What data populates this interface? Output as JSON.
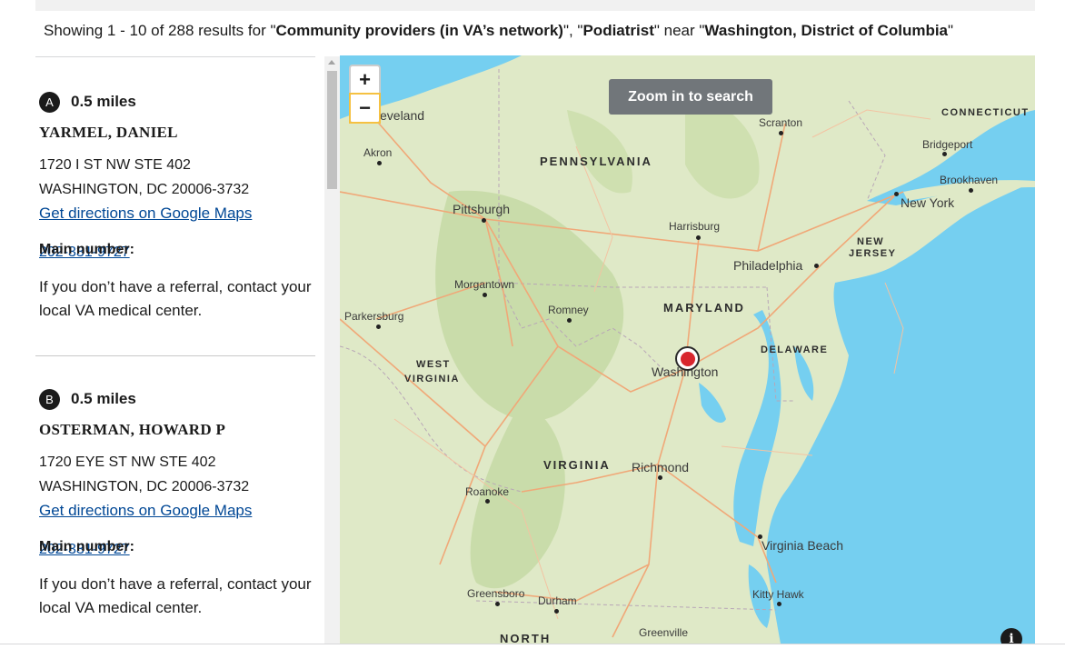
{
  "summary": {
    "prefix": "Showing 1 - 10 of 288 results for \"",
    "service_type": "Community providers (in VA’s network)",
    "mid1": "\", \"",
    "specialty": "Podiatrist",
    "mid2": "\" near \"",
    "location": "Washington, District of Columbia",
    "suffix": "\""
  },
  "results": [
    {
      "marker": "A",
      "distance": "0.5 miles",
      "name": "YARMEL, DANIEL",
      "address_line1": "1720 I ST NW STE 402",
      "address_line2": "WASHINGTON, DC 20006-3732",
      "directions_label": "Get directions on Google Maps",
      "phone_label": "Main number:",
      "phone": "202-331-9727",
      "note": "If you don’t have a referral, contact your local VA medical center."
    },
    {
      "marker": "B",
      "distance": "0.5 miles",
      "name": "OSTERMAN, HOWARD P",
      "address_line1": "1720 EYE ST NW STE 402",
      "address_line2": "WASHINGTON, DC 20006-3732",
      "directions_label": "Get directions on Google Maps",
      "phone_label": "Main number:",
      "phone": "202-331-9727",
      "note": "If you don’t have a referral, contact your local VA medical center."
    }
  ],
  "map": {
    "zoom_in_label": "+",
    "zoom_out_label": "−",
    "zoom_to_search_label": "Zoom in to search",
    "info_label": "i",
    "states": {
      "pennsylvania": "PENNSYLVANIA",
      "connecticut": "CONNECTICUT",
      "new_jersey_1": "NEW",
      "new_jersey_2": "JERSEY",
      "maryland": "MARYLAND",
      "delaware": "DELAWARE",
      "west_virginia_1": "WEST",
      "west_virginia_2": "VIRGINIA",
      "virginia": "VIRGINIA",
      "north": "NORTH"
    },
    "cities": {
      "cleveland": "eveland",
      "akron": "Akron",
      "scranton": "Scranton",
      "bridgeport": "Bridgeport",
      "brookhaven": "Brookhaven",
      "new_york": "New York",
      "pittsburgh": "Pittsburgh",
      "harrisburg": "Harrisburg",
      "philadelphia": "Philadelphia",
      "morgantown": "Morgantown",
      "romney": "Romney",
      "parkersburg": "Parkersburg",
      "washington": "Washington",
      "richmond": "Richmond",
      "roanoke": "Roanoke",
      "virginia_beach": "Virginia Beach",
      "kitty_hawk": "Kitty Hawk",
      "greensboro": "Greensboro",
      "durham": "Durham",
      "greenville": "Greenville"
    },
    "colors": {
      "water": "#75cff0",
      "land": "#dfe9c7",
      "forest": "#c9dcaa",
      "road": "#f0a878",
      "pin": "#d8262e"
    }
  }
}
